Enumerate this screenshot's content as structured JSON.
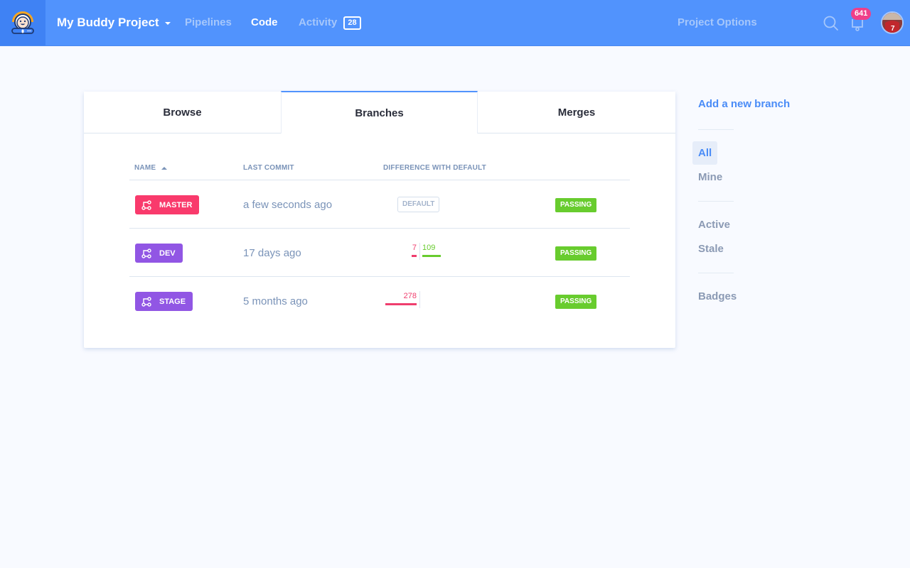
{
  "header": {
    "logo_icon": "buddy-astronaut-logo",
    "project_name": "My Buddy Project",
    "nav": [
      {
        "label": "Pipelines",
        "active": false
      },
      {
        "label": "Code",
        "active": true
      },
      {
        "label": "Activity",
        "active": false,
        "count": "28"
      }
    ],
    "project_options": "Project Options",
    "search_icon": "search-icon",
    "notifications_icon": "bell-icon",
    "notifications_count": "641",
    "avatar_icon": "user-avatar"
  },
  "tabs": [
    {
      "label": "Browse",
      "active": false
    },
    {
      "label": "Branches",
      "active": true
    },
    {
      "label": "Merges",
      "active": false
    }
  ],
  "table": {
    "columns": {
      "name": "NAME",
      "last_commit": "LAST COMMIT",
      "difference": "DIFFERENCE WITH DEFAULT"
    },
    "sort": {
      "column": "name",
      "direction": "ascending"
    },
    "rows": [
      {
        "name": "MASTER",
        "color": "#f93a6c",
        "last_commit": "a few seconds ago",
        "is_default": true,
        "default_label": "DEFAULT",
        "behind": null,
        "ahead": null,
        "status": "PASSING"
      },
      {
        "name": "DEV",
        "color": "#9156e4",
        "last_commit": "17 days ago",
        "is_default": false,
        "behind": "7",
        "ahead": "109",
        "status": "PASSING"
      },
      {
        "name": "STAGE",
        "color": "#9156e4",
        "last_commit": "5 months ago",
        "is_default": false,
        "behind": "278",
        "ahead": null,
        "status": "PASSING"
      }
    ]
  },
  "colors": {
    "brand": "#5193fd",
    "passing": "#68cc2e",
    "behind": "#ef3e6e",
    "ahead": "#68cc2e",
    "link": "#4a8cf7"
  },
  "sidebar": {
    "add_branch": "Add a new branch",
    "filters_owner": [
      {
        "label": "All",
        "active": true
      },
      {
        "label": "Mine",
        "active": false
      }
    ],
    "filters_state": [
      {
        "label": "Active",
        "active": false
      },
      {
        "label": "Stale",
        "active": false
      }
    ],
    "badges": "Badges"
  }
}
